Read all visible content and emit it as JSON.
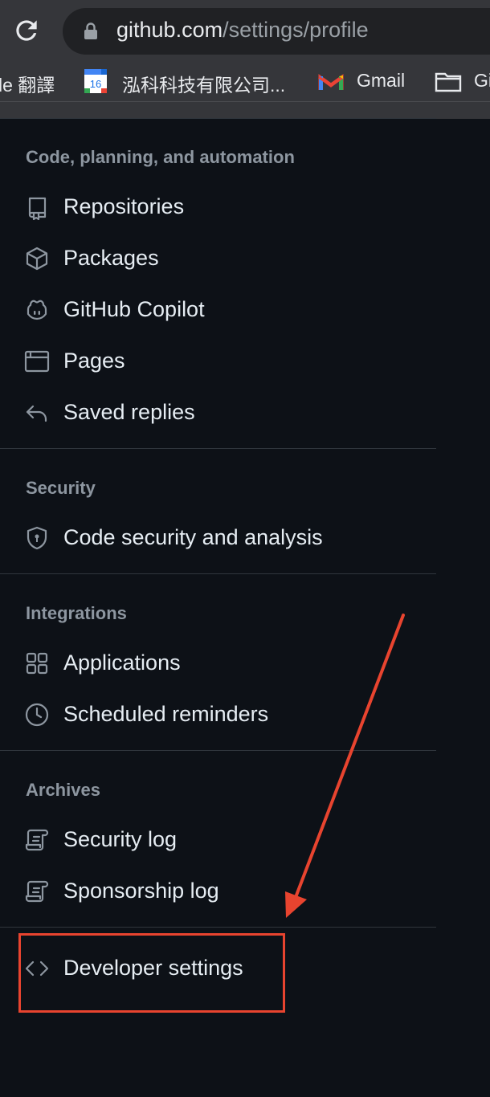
{
  "browser": {
    "url_host": "github.com",
    "url_path": "/settings/profile",
    "bookmarks": [
      {
        "label": "le 翻譯",
        "icon": "translate-icon"
      },
      {
        "label": "泓科科技有限公司...",
        "icon": "calendar-icon",
        "badge": "16"
      },
      {
        "label": "Gmail",
        "icon": "gmail-icon"
      },
      {
        "label": "Gi",
        "icon": "folder-icon"
      }
    ]
  },
  "sidebar": {
    "sections": [
      {
        "title": "Code, planning, and automation",
        "items": [
          {
            "label": "Repositories",
            "icon": "repo-icon"
          },
          {
            "label": "Packages",
            "icon": "package-icon"
          },
          {
            "label": "GitHub Copilot",
            "icon": "copilot-icon"
          },
          {
            "label": "Pages",
            "icon": "browser-icon"
          },
          {
            "label": "Saved replies",
            "icon": "reply-icon"
          }
        ]
      },
      {
        "title": "Security",
        "items": [
          {
            "label": "Code security and analysis",
            "icon": "shield-lock-icon"
          }
        ]
      },
      {
        "title": "Integrations",
        "items": [
          {
            "label": "Applications",
            "icon": "apps-icon"
          },
          {
            "label": "Scheduled reminders",
            "icon": "clock-icon"
          }
        ]
      },
      {
        "title": "Archives",
        "items": [
          {
            "label": "Security log",
            "icon": "log-icon"
          },
          {
            "label": "Sponsorship log",
            "icon": "log-icon"
          }
        ]
      }
    ],
    "developer_settings": {
      "label": "Developer settings",
      "icon": "code-icon"
    }
  },
  "colors": {
    "background": "#0d1117",
    "text": "#e6edf3",
    "muted": "#8d96a0",
    "annotation": "#e8442f"
  }
}
